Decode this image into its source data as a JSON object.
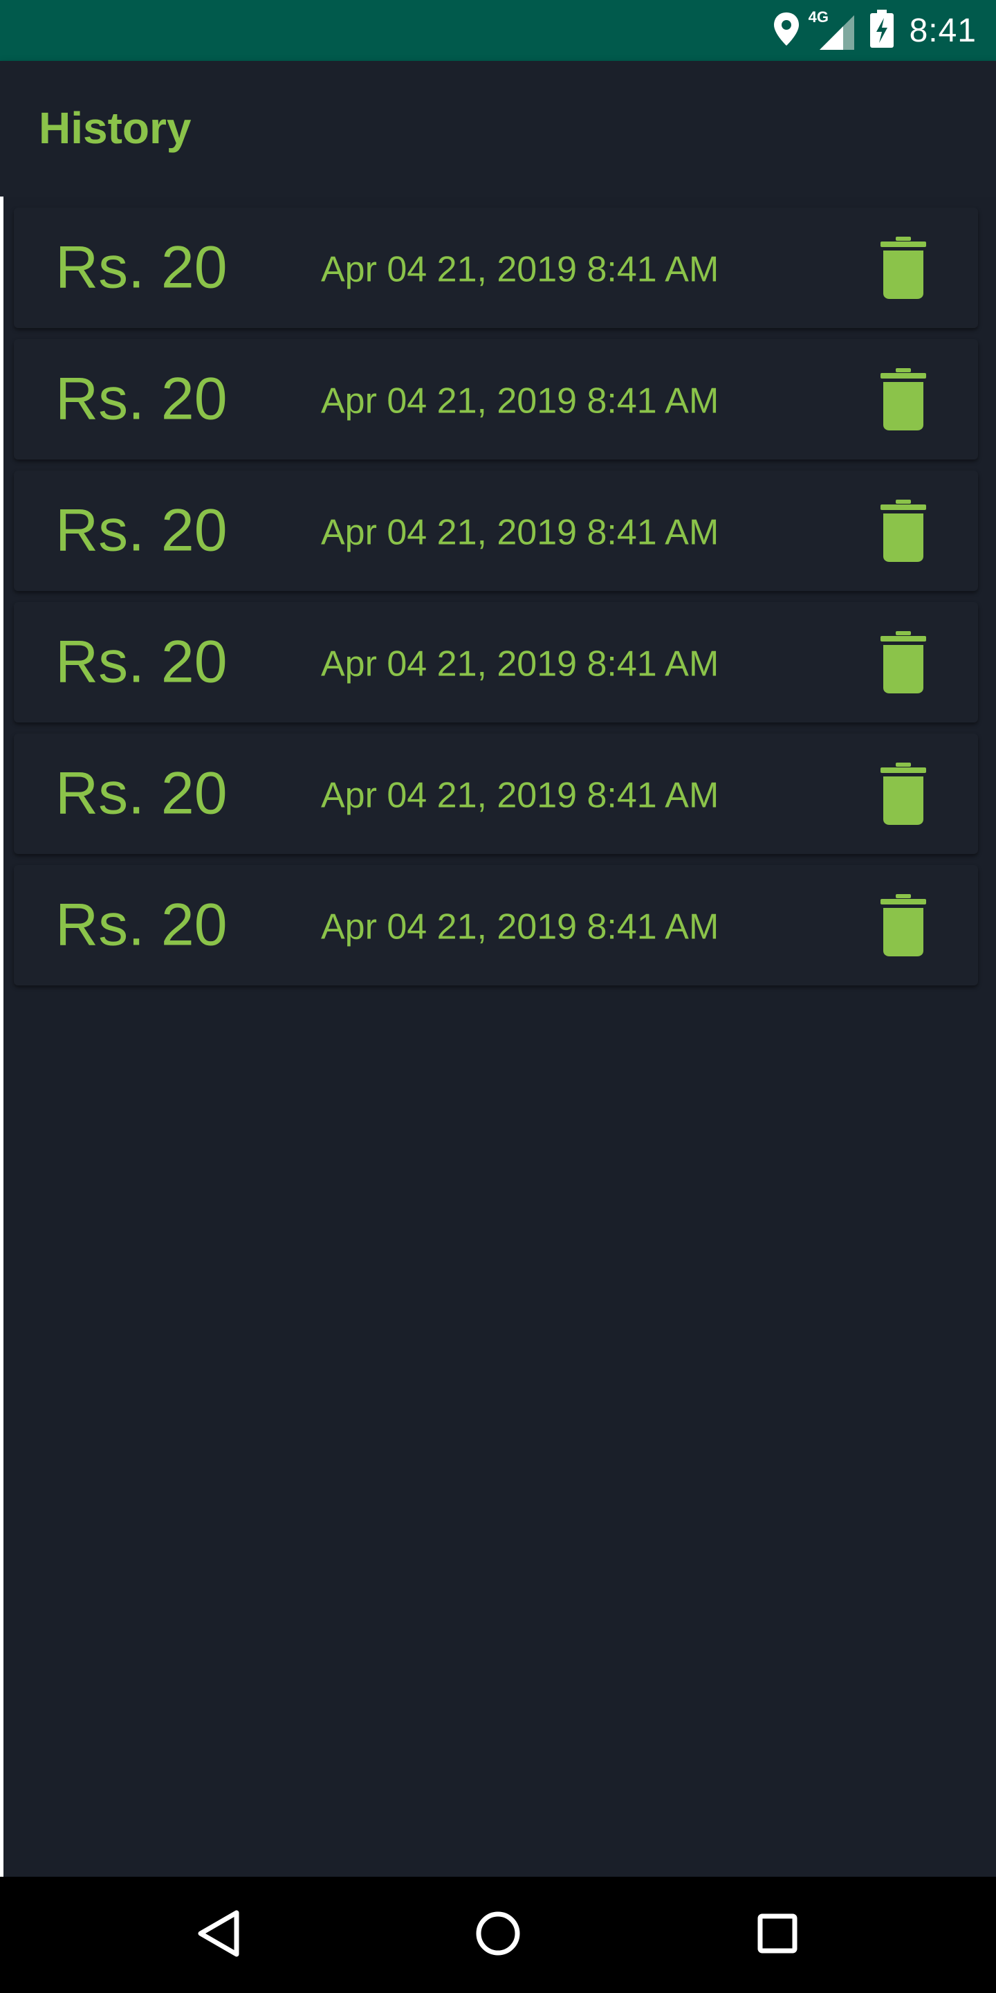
{
  "status_bar": {
    "time": "8:41",
    "network_label": "4G",
    "icons": [
      "location-icon",
      "signal-4g-icon",
      "battery-charging-icon"
    ],
    "background_color": "#015a4c"
  },
  "app_bar": {
    "title": "History",
    "accent_color": "#8bc34a"
  },
  "history": {
    "items": [
      {
        "amount": "Rs. 20",
        "date": "Apr 04 21, 2019 8:41 AM",
        "action_icon": "trash-icon"
      },
      {
        "amount": "Rs. 20",
        "date": "Apr 04 21, 2019 8:41 AM",
        "action_icon": "trash-icon"
      },
      {
        "amount": "Rs. 20",
        "date": "Apr 04 21, 2019 8:41 AM",
        "action_icon": "trash-icon"
      },
      {
        "amount": "Rs. 20",
        "date": "Apr 04 21, 2019 8:41 AM",
        "action_icon": "trash-icon"
      },
      {
        "amount": "Rs. 20",
        "date": "Apr 04 21, 2019 8:41 AM",
        "action_icon": "trash-icon"
      },
      {
        "amount": "Rs. 20",
        "date": "Apr 04 21, 2019 8:41 AM",
        "action_icon": "trash-icon"
      }
    ]
  },
  "nav_bar": {
    "buttons": [
      "back-icon",
      "home-icon",
      "recents-icon"
    ]
  },
  "colors": {
    "background": "#1a1f29",
    "card": "#1c212b",
    "accent": "#8bc34a"
  }
}
